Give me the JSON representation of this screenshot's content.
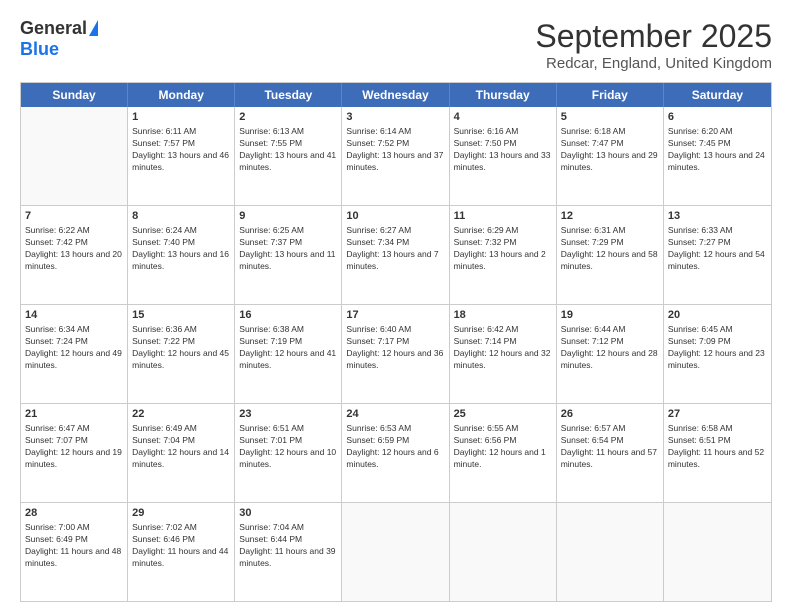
{
  "header": {
    "logo_general": "General",
    "logo_blue": "Blue",
    "month_title": "September 2025",
    "subtitle": "Redcar, England, United Kingdom"
  },
  "days": [
    "Sunday",
    "Monday",
    "Tuesday",
    "Wednesday",
    "Thursday",
    "Friday",
    "Saturday"
  ],
  "rows": [
    [
      {
        "day": "",
        "sunrise": "",
        "sunset": "",
        "daylight": ""
      },
      {
        "day": "1",
        "sunrise": "Sunrise: 6:11 AM",
        "sunset": "Sunset: 7:57 PM",
        "daylight": "Daylight: 13 hours and 46 minutes."
      },
      {
        "day": "2",
        "sunrise": "Sunrise: 6:13 AM",
        "sunset": "Sunset: 7:55 PM",
        "daylight": "Daylight: 13 hours and 41 minutes."
      },
      {
        "day": "3",
        "sunrise": "Sunrise: 6:14 AM",
        "sunset": "Sunset: 7:52 PM",
        "daylight": "Daylight: 13 hours and 37 minutes."
      },
      {
        "day": "4",
        "sunrise": "Sunrise: 6:16 AM",
        "sunset": "Sunset: 7:50 PM",
        "daylight": "Daylight: 13 hours and 33 minutes."
      },
      {
        "day": "5",
        "sunrise": "Sunrise: 6:18 AM",
        "sunset": "Sunset: 7:47 PM",
        "daylight": "Daylight: 13 hours and 29 minutes."
      },
      {
        "day": "6",
        "sunrise": "Sunrise: 6:20 AM",
        "sunset": "Sunset: 7:45 PM",
        "daylight": "Daylight: 13 hours and 24 minutes."
      }
    ],
    [
      {
        "day": "7",
        "sunrise": "Sunrise: 6:22 AM",
        "sunset": "Sunset: 7:42 PM",
        "daylight": "Daylight: 13 hours and 20 minutes."
      },
      {
        "day": "8",
        "sunrise": "Sunrise: 6:24 AM",
        "sunset": "Sunset: 7:40 PM",
        "daylight": "Daylight: 13 hours and 16 minutes."
      },
      {
        "day": "9",
        "sunrise": "Sunrise: 6:25 AM",
        "sunset": "Sunset: 7:37 PM",
        "daylight": "Daylight: 13 hours and 11 minutes."
      },
      {
        "day": "10",
        "sunrise": "Sunrise: 6:27 AM",
        "sunset": "Sunset: 7:34 PM",
        "daylight": "Daylight: 13 hours and 7 minutes."
      },
      {
        "day": "11",
        "sunrise": "Sunrise: 6:29 AM",
        "sunset": "Sunset: 7:32 PM",
        "daylight": "Daylight: 13 hours and 2 minutes."
      },
      {
        "day": "12",
        "sunrise": "Sunrise: 6:31 AM",
        "sunset": "Sunset: 7:29 PM",
        "daylight": "Daylight: 12 hours and 58 minutes."
      },
      {
        "day": "13",
        "sunrise": "Sunrise: 6:33 AM",
        "sunset": "Sunset: 7:27 PM",
        "daylight": "Daylight: 12 hours and 54 minutes."
      }
    ],
    [
      {
        "day": "14",
        "sunrise": "Sunrise: 6:34 AM",
        "sunset": "Sunset: 7:24 PM",
        "daylight": "Daylight: 12 hours and 49 minutes."
      },
      {
        "day": "15",
        "sunrise": "Sunrise: 6:36 AM",
        "sunset": "Sunset: 7:22 PM",
        "daylight": "Daylight: 12 hours and 45 minutes."
      },
      {
        "day": "16",
        "sunrise": "Sunrise: 6:38 AM",
        "sunset": "Sunset: 7:19 PM",
        "daylight": "Daylight: 12 hours and 41 minutes."
      },
      {
        "day": "17",
        "sunrise": "Sunrise: 6:40 AM",
        "sunset": "Sunset: 7:17 PM",
        "daylight": "Daylight: 12 hours and 36 minutes."
      },
      {
        "day": "18",
        "sunrise": "Sunrise: 6:42 AM",
        "sunset": "Sunset: 7:14 PM",
        "daylight": "Daylight: 12 hours and 32 minutes."
      },
      {
        "day": "19",
        "sunrise": "Sunrise: 6:44 AM",
        "sunset": "Sunset: 7:12 PM",
        "daylight": "Daylight: 12 hours and 28 minutes."
      },
      {
        "day": "20",
        "sunrise": "Sunrise: 6:45 AM",
        "sunset": "Sunset: 7:09 PM",
        "daylight": "Daylight: 12 hours and 23 minutes."
      }
    ],
    [
      {
        "day": "21",
        "sunrise": "Sunrise: 6:47 AM",
        "sunset": "Sunset: 7:07 PM",
        "daylight": "Daylight: 12 hours and 19 minutes."
      },
      {
        "day": "22",
        "sunrise": "Sunrise: 6:49 AM",
        "sunset": "Sunset: 7:04 PM",
        "daylight": "Daylight: 12 hours and 14 minutes."
      },
      {
        "day": "23",
        "sunrise": "Sunrise: 6:51 AM",
        "sunset": "Sunset: 7:01 PM",
        "daylight": "Daylight: 12 hours and 10 minutes."
      },
      {
        "day": "24",
        "sunrise": "Sunrise: 6:53 AM",
        "sunset": "Sunset: 6:59 PM",
        "daylight": "Daylight: 12 hours and 6 minutes."
      },
      {
        "day": "25",
        "sunrise": "Sunrise: 6:55 AM",
        "sunset": "Sunset: 6:56 PM",
        "daylight": "Daylight: 12 hours and 1 minute."
      },
      {
        "day": "26",
        "sunrise": "Sunrise: 6:57 AM",
        "sunset": "Sunset: 6:54 PM",
        "daylight": "Daylight: 11 hours and 57 minutes."
      },
      {
        "day": "27",
        "sunrise": "Sunrise: 6:58 AM",
        "sunset": "Sunset: 6:51 PM",
        "daylight": "Daylight: 11 hours and 52 minutes."
      }
    ],
    [
      {
        "day": "28",
        "sunrise": "Sunrise: 7:00 AM",
        "sunset": "Sunset: 6:49 PM",
        "daylight": "Daylight: 11 hours and 48 minutes."
      },
      {
        "day": "29",
        "sunrise": "Sunrise: 7:02 AM",
        "sunset": "Sunset: 6:46 PM",
        "daylight": "Daylight: 11 hours and 44 minutes."
      },
      {
        "day": "30",
        "sunrise": "Sunrise: 7:04 AM",
        "sunset": "Sunset: 6:44 PM",
        "daylight": "Daylight: 11 hours and 39 minutes."
      },
      {
        "day": "",
        "sunrise": "",
        "sunset": "",
        "daylight": ""
      },
      {
        "day": "",
        "sunrise": "",
        "sunset": "",
        "daylight": ""
      },
      {
        "day": "",
        "sunrise": "",
        "sunset": "",
        "daylight": ""
      },
      {
        "day": "",
        "sunrise": "",
        "sunset": "",
        "daylight": ""
      }
    ]
  ]
}
